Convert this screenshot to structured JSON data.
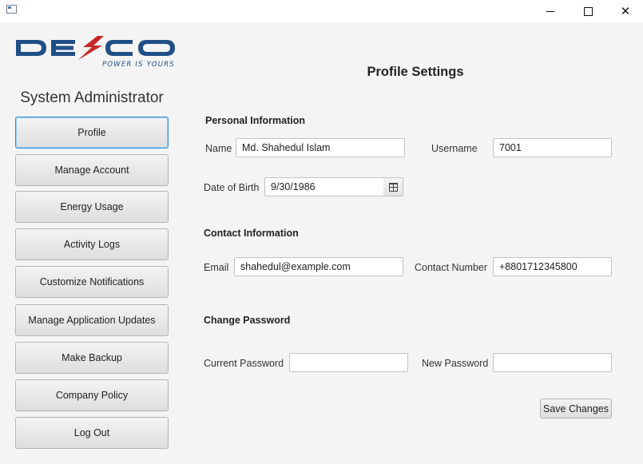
{
  "window": {
    "minimize_icon": "minimize-icon",
    "maximize_icon": "maximize-icon",
    "close_icon": "close-icon"
  },
  "logo": {
    "tagline": "POWER IS YOURS",
    "colors": {
      "blue": "#1f4f86",
      "red": "#c62828"
    }
  },
  "sidebar": {
    "role": "System Administrator",
    "items": [
      {
        "label": "Profile",
        "active": true
      },
      {
        "label": "Manage Account"
      },
      {
        "label": "Energy Usage"
      },
      {
        "label": "Activity Logs"
      },
      {
        "label": "Customize Notifications"
      },
      {
        "label": "Manage Application Updates"
      },
      {
        "label": "Make Backup"
      },
      {
        "label": "Company Policy"
      },
      {
        "label": "Log Out"
      }
    ]
  },
  "main": {
    "title": "Profile Settings",
    "personal": {
      "title": "Personal Information",
      "name_label": "Name",
      "name_value": "Md. Shahedul Islam",
      "username_label": "Username",
      "username_value": "7001",
      "dob_label": "Date of Birth",
      "dob_value": "9/30/1986"
    },
    "contact": {
      "title": "Contact Information",
      "email_label": "Email",
      "email_value": "shahedul@example.com",
      "phone_label": "Contact Number",
      "phone_value": "+8801712345800"
    },
    "password": {
      "title": "Change Password",
      "current_label": "Current Password",
      "current_value": "",
      "new_label": "New Password",
      "new_value": ""
    },
    "save_label": "Save Changes"
  }
}
